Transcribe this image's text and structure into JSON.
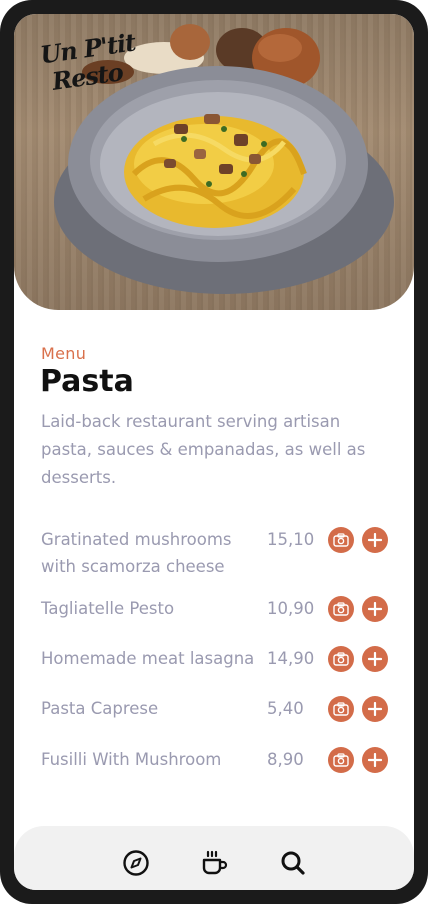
{
  "brand": {
    "logo_line1": "Un P'tit",
    "logo_line2": "Resto"
  },
  "header": {
    "eyebrow": "Menu",
    "title": "Pasta",
    "description": "Laid-back restaurant serving artisan pasta, sauces & empanadas, as well as desserts."
  },
  "menu": {
    "items": [
      {
        "name": "Gratinated mushrooms with scamorza cheese",
        "price": "15,10"
      },
      {
        "name": "Tagliatelle Pesto",
        "price": "10,90"
      },
      {
        "name": "Homemade meat lasagna",
        "price": "14,90"
      },
      {
        "name": "Pasta Caprese",
        "price": "5,40"
      },
      {
        "name": "Fusilli With Mushroom",
        "price": "8,90"
      }
    ]
  },
  "icons": {
    "photo": "camera-icon",
    "add": "plus-icon",
    "nav": [
      "compass-icon",
      "coffee-cup-icon",
      "search-icon"
    ]
  },
  "colors": {
    "accent": "#d36c49",
    "eyebrow": "#d9704b",
    "muted_text": "#9a9ab0",
    "nav_bg": "#f1f1f1"
  }
}
